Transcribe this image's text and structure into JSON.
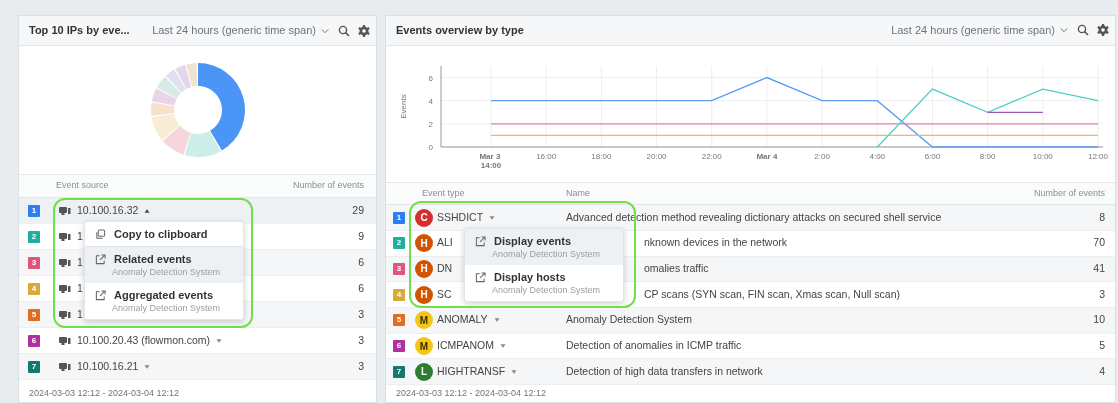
{
  "left_panel": {
    "title": "Top 10 IPs by eve...",
    "time_span": "Last 24 hours (generic time span)",
    "table": {
      "columns": [
        "Event source",
        "Number of events"
      ],
      "rows": [
        {
          "rank": "1",
          "color": "#2d7ff0",
          "ip": "10.100.16.32",
          "expanded": true,
          "count": "29"
        },
        {
          "rank": "2",
          "color": "#1fae9f",
          "ip": "1",
          "count": "9"
        },
        {
          "rank": "3",
          "color": "#e0557e",
          "ip": "1",
          "count": "6"
        },
        {
          "rank": "4",
          "color": "#d9a93a",
          "ip": "1",
          "count": "6"
        },
        {
          "rank": "5",
          "color": "#e26d1f",
          "ip": "1",
          "count": "3"
        },
        {
          "rank": "6",
          "color": "#b0309f",
          "ip": "10.100.20.43 (flowmon.com)",
          "expanded": false,
          "count": "3"
        },
        {
          "rank": "7",
          "color": "#14786e",
          "ip": "10.100.16.21",
          "expanded": false,
          "count": "3"
        }
      ]
    },
    "context_menu": {
      "items": [
        {
          "kind": "copy",
          "label": "Copy to clipboard",
          "highlighted": false
        },
        {
          "kind": "link",
          "label": "Related events",
          "subtitle": "Anomaly Detection System",
          "highlighted": true
        },
        {
          "kind": "link",
          "label": "Aggregated events",
          "subtitle": "Anomaly Detection System",
          "highlighted": false
        }
      ]
    },
    "footer": "2024-03-03 12:12 - 2024-03-04 12:12"
  },
  "right_panel": {
    "title": "Events overview by type",
    "time_span": "Last 24 hours (generic time span)",
    "chart_data": {
      "type": "line",
      "ylabel": "Events",
      "grid": true,
      "categories": [
        "Mar 3 14:00",
        "16:00",
        "18:00",
        "20:00",
        "22:00",
        "Mar 4",
        "2:00",
        "4:00",
        "6:00",
        "8:00",
        "10:00",
        "12:00"
      ],
      "ylim": [
        0,
        7
      ],
      "yticks": [
        0,
        2,
        4,
        6
      ],
      "series": [
        {
          "color": "#5b9cf0",
          "values": [
            4,
            4,
            4,
            4,
            4,
            6,
            4,
            4,
            0,
            0,
            0,
            0
          ]
        },
        {
          "color": "#e87da8",
          "values": [
            2,
            2,
            2,
            2,
            2,
            2,
            2,
            2,
            2,
            2,
            2,
            2
          ]
        },
        {
          "color": "#f0b860",
          "values": [
            1,
            1,
            1,
            1,
            1,
            1,
            1,
            1,
            1,
            1,
            1,
            1
          ]
        },
        {
          "color": "#4fd1c5",
          "values": [
            null,
            null,
            null,
            null,
            null,
            null,
            null,
            0,
            5,
            3,
            5,
            4
          ]
        },
        {
          "color": "#9b59b6",
          "values": [
            null,
            null,
            null,
            null,
            null,
            null,
            null,
            null,
            null,
            3,
            3,
            null
          ]
        }
      ]
    },
    "table": {
      "columns": [
        "Event type",
        "Name",
        "Number of events"
      ],
      "rows": [
        {
          "rank": "1",
          "color": "#2d7ff0",
          "severity": {
            "letter": "C",
            "color": "#d32f2f"
          },
          "type": "SSHDICT",
          "expanded": false,
          "name": "Advanced detection method revealing dictionary attacks on secured shell service",
          "count": "8"
        },
        {
          "rank": "2",
          "color": "#1fae9f",
          "severity": {
            "letter": "H",
            "color": "#d35400"
          },
          "type": "ALI",
          "name": "nknown devices in the network",
          "name_covered": true,
          "count": "70"
        },
        {
          "rank": "3",
          "color": "#e0557e",
          "severity": {
            "letter": "H",
            "color": "#d35400"
          },
          "type": "DN",
          "name": "omalies traffic",
          "name_covered": true,
          "count": "41"
        },
        {
          "rank": "4",
          "color": "#d9a93a",
          "severity": {
            "letter": "H",
            "color": "#d35400"
          },
          "type": "SC",
          "name": "CP scans (SYN scan, FIN scan, Xmas scan, Null scan)",
          "name_covered": true,
          "count": "3"
        },
        {
          "rank": "5",
          "color": "#e26d1f",
          "severity": {
            "letter": "M",
            "color": "#f5c518"
          },
          "type": "ANOMALY",
          "expanded": false,
          "name": "Anomaly Detection System",
          "count": "10"
        },
        {
          "rank": "6",
          "color": "#b0309f",
          "severity": {
            "letter": "M",
            "color": "#f5c518"
          },
          "type": "ICMPANOM",
          "expanded": false,
          "name": "Detection of anomalies in ICMP traffic",
          "count": "5"
        },
        {
          "rank": "7",
          "color": "#14786e",
          "severity": {
            "letter": "L",
            "color": "#2e7d32"
          },
          "type": "HIGHTRANSF",
          "expanded": false,
          "name": "Detection of high data transfers in network",
          "count": "4"
        }
      ]
    },
    "context_menu": {
      "items": [
        {
          "kind": "link",
          "label": "Display events",
          "subtitle": "Anomaly Detection System",
          "highlighted": true
        },
        {
          "kind": "link",
          "label": "Display hosts",
          "subtitle": "Anomaly Detection System",
          "highlighted": false
        }
      ]
    },
    "footer": "2024-03-03 12:12 - 2024-03-04 12:12"
  }
}
